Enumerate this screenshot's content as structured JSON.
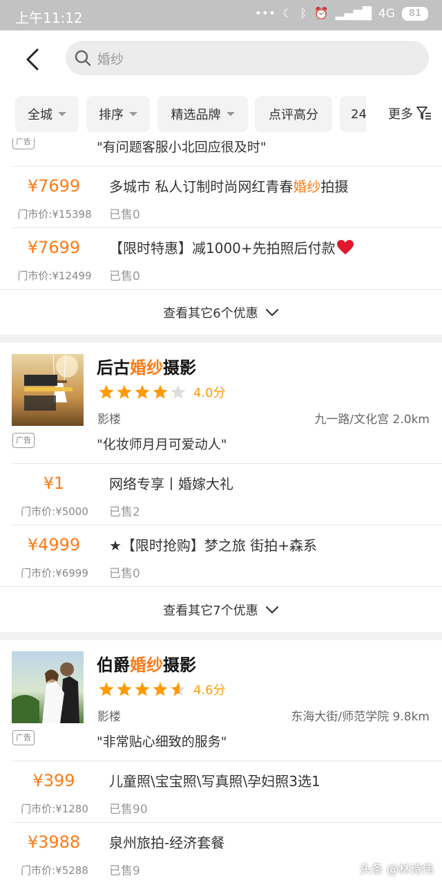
{
  "status_bar": {
    "time": "上午11:12",
    "network": "4G",
    "battery": "81"
  },
  "search": {
    "query": "婚纱"
  },
  "filters": [
    {
      "label": "全城",
      "has_caret": true
    },
    {
      "label": "排序",
      "has_caret": true
    },
    {
      "label": "精选品牌",
      "has_caret": true
    },
    {
      "label": "点评高分",
      "has_caret": false
    },
    {
      "label": "24",
      "has_caret": false
    }
  ],
  "filters_more": "更多",
  "card1": {
    "review_partial": "\"有问题客服小北回应很及时\"",
    "ad_label": "广告",
    "deals": [
      {
        "price": "¥7699",
        "original": "门市价:¥15398",
        "title_prefix": "多城市 私人订制时尚网红青春",
        "title_hl": "婚纱",
        "title_suffix": "拍摄",
        "sold": "已售0"
      },
      {
        "price": "¥7699",
        "original": "门市价:¥12499",
        "title_prefix": "【限时特惠】减1000+先拍照后付款",
        "title_hl": "",
        "title_suffix": "",
        "sold": "已售0"
      }
    ],
    "more_deals": "查看其它6个优惠"
  },
  "card2": {
    "name_prefix": "后古",
    "name_hl": "婚纱",
    "name_suffix": "摄影",
    "rating": 4.0,
    "score": "4.0分",
    "category": "影楼",
    "location": "九一路/文化宫 2.0km",
    "review": "\"化妆师月月可爱动人\"",
    "ad_label": "广告",
    "deals": [
      {
        "price": "¥1",
        "original": "门市价:¥5000",
        "title": "网络专享丨婚嫁大礼",
        "sold": "已售2"
      },
      {
        "price": "¥4999",
        "original": "门市价:¥6999",
        "title": "★【限时抢购】梦之旅 街拍+森系",
        "sold": "已售0"
      }
    ],
    "more_deals": "查看其它7个优惠"
  },
  "card3": {
    "name_prefix": "伯爵",
    "name_hl": "婚纱",
    "name_suffix": "摄影",
    "rating": 4.6,
    "score": "4.6分",
    "category": "影楼",
    "location": "东海大街/师范学院 9.8km",
    "review": "\"非常贴心细致的服务\"",
    "ad_label": "广告",
    "deals": [
      {
        "price": "¥399",
        "original": "门市价:¥1280",
        "title": "儿童照\\宝宝照\\写真照\\孕妇照3选1",
        "sold": "已售90"
      },
      {
        "price": "¥3988",
        "original": "门市价:¥5288",
        "title": "泉州旅拍-经济套餐",
        "sold": "已售9"
      }
    ]
  },
  "watermark": "头条 @林诗伟",
  "colors": {
    "accent": "#ff7a14",
    "star": "#ff9a00",
    "star_empty": "#dddddd",
    "heart": "#e0182c"
  }
}
